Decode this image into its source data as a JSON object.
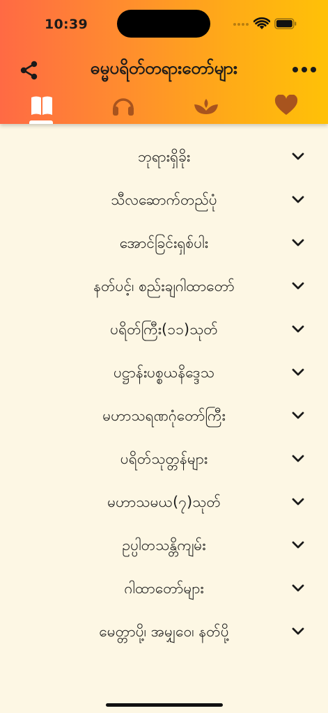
{
  "status_bar": {
    "time": "10:39"
  },
  "header": {
    "title": "ဓမ္မပရိတ်တရားတော်များ",
    "share_icon": "share-icon",
    "more_icon": "more-horizontal-icon"
  },
  "tabs": [
    {
      "icon": "book-open-icon",
      "active": true
    },
    {
      "icon": "headphones-icon",
      "active": false
    },
    {
      "icon": "meditation-lotus-icon",
      "active": false
    },
    {
      "icon": "heart-icon",
      "active": false
    }
  ],
  "menu": {
    "items": [
      {
        "label": "ဘုရားရှိခိုး"
      },
      {
        "label": "သီလဆောက်တည်ပုံ"
      },
      {
        "label": "အောင်ခြင်းရှစ်ပါး"
      },
      {
        "label": "နတ်ပင့်၊ စည်းချဂါထာတော်"
      },
      {
        "label": "ပရိတ်ကြီး(၁၁)သုတ်"
      },
      {
        "label": "ပဋ္ဌာန်းပစ္စယနိဒ္ဒေသ"
      },
      {
        "label": "မဟာသရဏဂုံတော်ကြီး"
      },
      {
        "label": "ပရိတ်သုတ္တန်များ"
      },
      {
        "label": "မဟာသမယ(၇)သုတ်"
      },
      {
        "label": "ဥပ္ပါတသန္တိကျမ်း"
      },
      {
        "label": "ဂါထာတော်များ"
      },
      {
        "label": "မေတ္တာပို့၊ အမျှဝေ၊ နတ်ပို့"
      }
    ],
    "expand_icon": "chevron-down-icon"
  },
  "colors": {
    "header_gradient_start": "#ff6a44",
    "header_gradient_end": "#ffc107",
    "background": "#fdf7e4",
    "tab_inactive": "#a8541e",
    "tab_active": "#ffffff"
  }
}
